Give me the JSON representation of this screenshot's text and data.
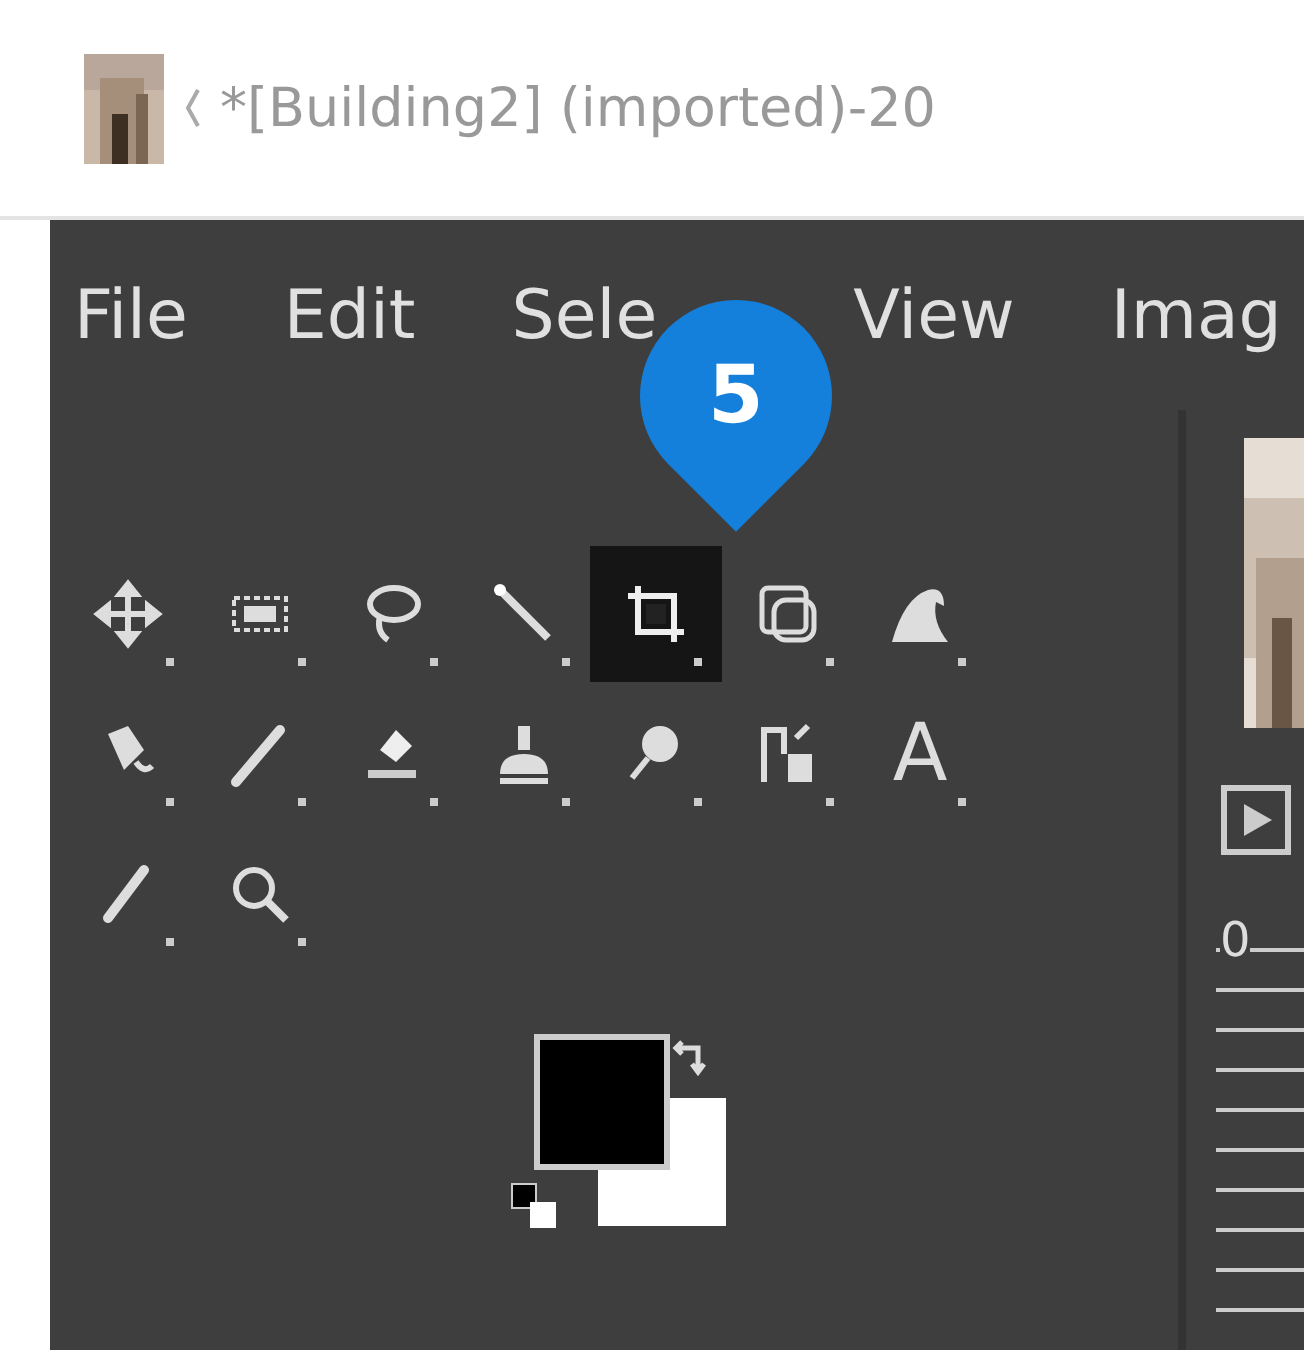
{
  "window": {
    "title": "*[Building2] (imported)-20"
  },
  "menu": [
    "File",
    "Edit",
    "Sele",
    "View",
    "Imag"
  ],
  "step_badge": {
    "label": "5"
  },
  "tools": [
    {
      "selected": false
    },
    {
      "selected": false
    },
    {
      "selected": false
    },
    {
      "selected": false
    },
    {
      "selected": true
    },
    {
      "selected": false
    },
    {
      "selected": false
    },
    {
      "selected": false
    },
    {
      "selected": false
    },
    {
      "selected": false
    },
    {
      "selected": false
    },
    {
      "selected": false
    },
    {
      "selected": false
    },
    {
      "selected": false,
      "glyph": "A"
    },
    {
      "selected": false
    },
    {
      "selected": false
    }
  ],
  "ruler": {
    "label": "0"
  }
}
